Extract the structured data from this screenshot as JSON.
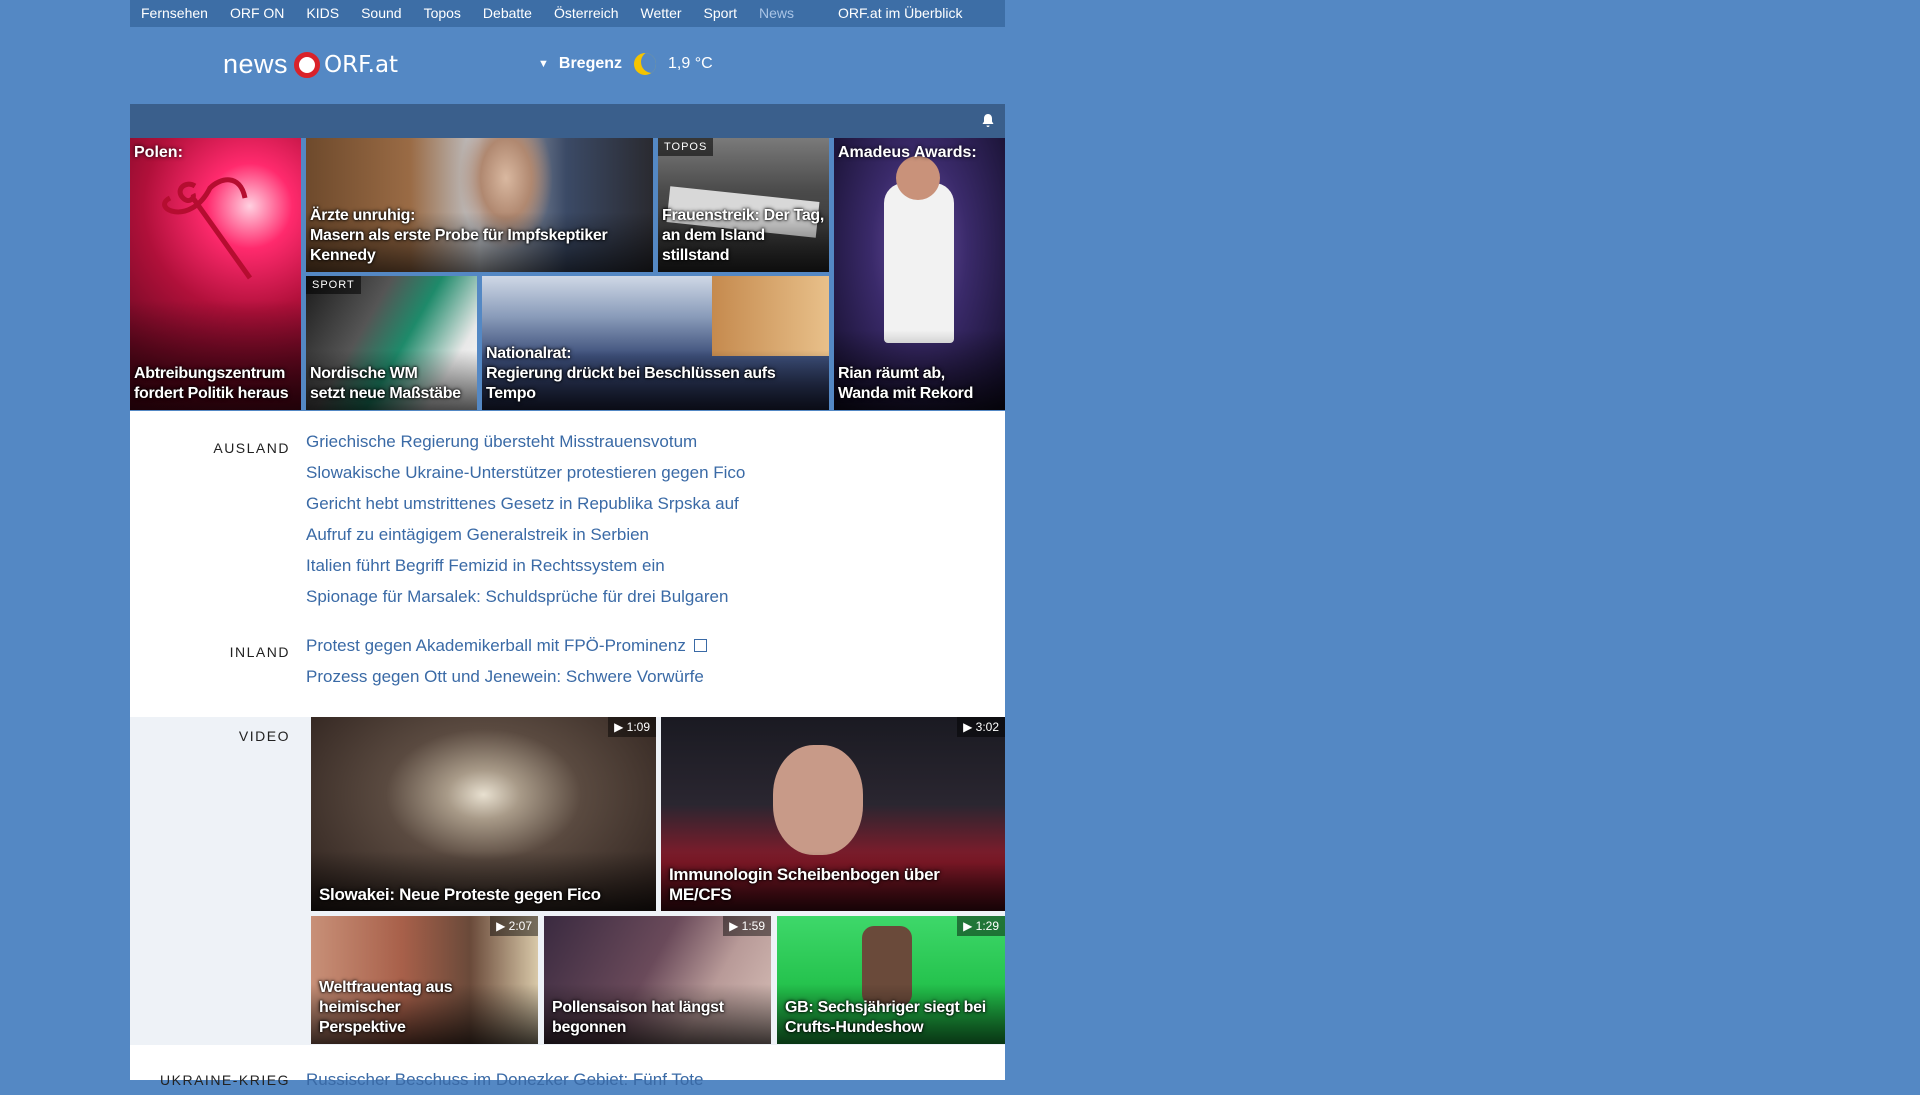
{
  "nav": {
    "items": [
      "Fernsehen",
      "ORF ON",
      "KIDS",
      "Sound",
      "Topos",
      "Debatte",
      "Österreich",
      "Wetter",
      "Sport",
      "News"
    ],
    "overview": "ORF.at im Überblick"
  },
  "logo": {
    "news": "news",
    "orf": "ORF.at"
  },
  "weather": {
    "location": "Bregenz",
    "temp": "1,9 °C"
  },
  "tiles": {
    "t1": {
      "top": "Polen:",
      "caption1": "Abtreibungszentrum",
      "caption2": "fordert Politik heraus"
    },
    "t2": {
      "caption1": "Ärzte unruhig:",
      "caption2": "Masern als erste Probe für Impfskeptiker Kennedy"
    },
    "t3": {
      "tag": "TOPOS",
      "caption1": "Frauenstreik: Der Tag,",
      "caption2": "an dem Island stillstand"
    },
    "t4": {
      "top": "Amadeus Awards:",
      "caption1": "Rian räumt ab,",
      "caption2": "Wanda mit Rekord"
    },
    "t5": {
      "tag": "SPORT",
      "caption1": "Nordische WM",
      "caption2": "setzt neue Maßstäbe"
    },
    "t6": {
      "caption1": "Nationalrat:",
      "caption2": "Regierung drückt bei Beschlüssen aufs Tempo"
    }
  },
  "ausland": {
    "label": "AUSLAND",
    "links": [
      "Griechische Regierung übersteht Misstrauensvotum",
      "Slowakische Ukraine-Unterstützer protestieren gegen Fico",
      "Gericht hebt umstrittenes Gesetz in Republika Srpska auf",
      "Aufruf zu eintägigem Generalstreik in Serbien",
      "Italien führt Begriff Femizid in Rechtssystem ein",
      "Spionage für Marsalek: Schuldsprüche für drei Bulgaren"
    ]
  },
  "inland": {
    "label": "INLAND",
    "links": [
      "Protest gegen Akademikerball mit FPÖ-Prominenz",
      "Prozess gegen Ott und Jenewein: Schwere Vorwürfe"
    ]
  },
  "video": {
    "label": "VIDEO",
    "items": [
      {
        "title": "Slowakei: Neue Proteste gegen Fico",
        "duration": "▶ 1:09"
      },
      {
        "title": "Immunologin Scheibenbogen über ME/CFS",
        "duration": "▶ 3:02"
      },
      {
        "title1": "Weltfrauentag aus heimischer",
        "title2": "Perspektive",
        "duration": "▶ 2:07"
      },
      {
        "title1": "Pollensaison hat längst",
        "title2": "begonnen",
        "duration": "▶ 1:59"
      },
      {
        "title1": "GB: Sechsjähriger siegt bei",
        "title2": "Crufts-Hundeshow",
        "duration": "▶ 1:29"
      }
    ]
  },
  "ukraine": {
    "label": "UKRAINE-KRIEG",
    "link": "Russischer Beschuss im Donezker Gebiet: Fünf Tote"
  }
}
